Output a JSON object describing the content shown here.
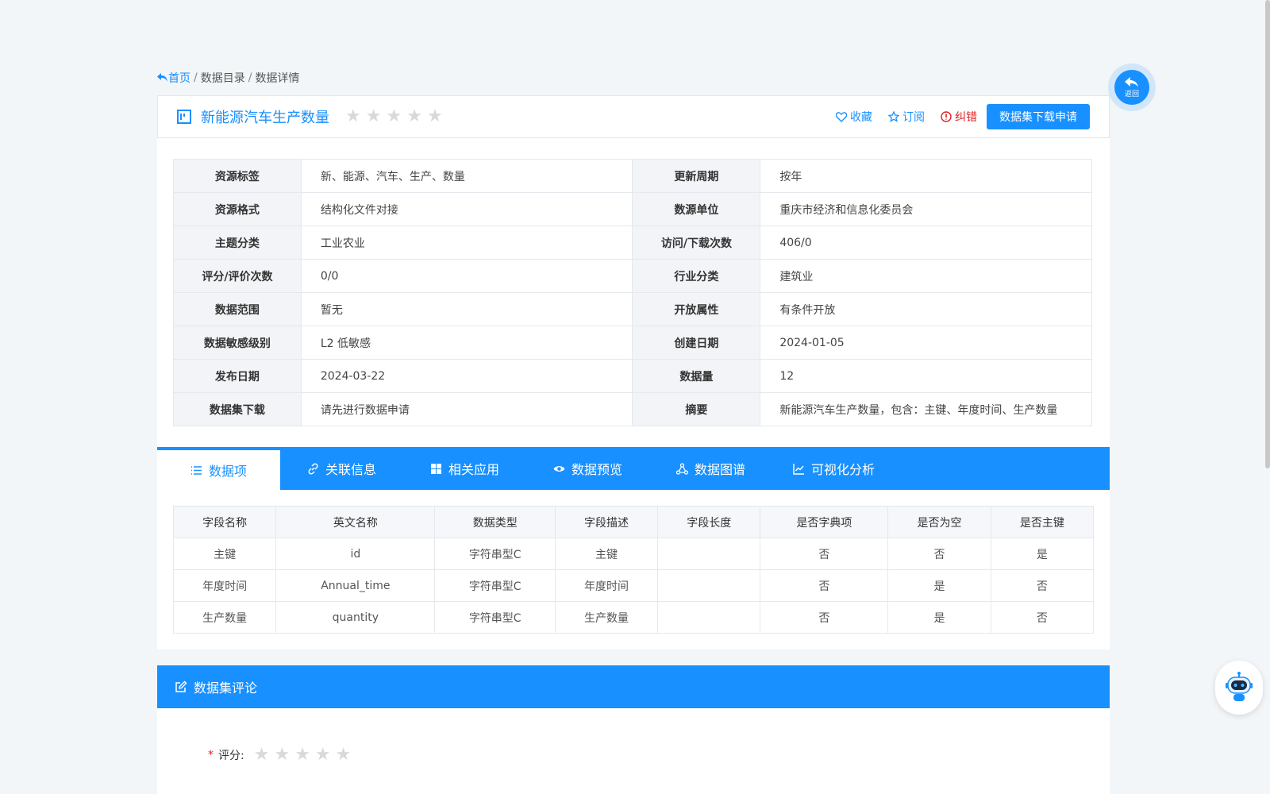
{
  "breadcrumb": {
    "home": "首页",
    "catalog": "数据目录",
    "detail": "数据详情"
  },
  "header": {
    "title": "新能源汽车生产数量",
    "favorite": "收藏",
    "subscribe": "订阅",
    "report_error": "纠错",
    "download_request": "数据集下载申请"
  },
  "info": [
    {
      "k1": "资源标签",
      "v1": "新、能源、汽车、生产、数量",
      "k2": "更新周期",
      "v2": "按年"
    },
    {
      "k1": "资源格式",
      "v1": "结构化文件对接",
      "k2": "数源单位",
      "v2": "重庆市经济和信息化委员会"
    },
    {
      "k1": "主题分类",
      "v1": "工业农业",
      "k2": "访问/下载次数",
      "v2": "406/0"
    },
    {
      "k1": "评分/评价次数",
      "v1": "0/0",
      "k2": "行业分类",
      "v2": "建筑业"
    },
    {
      "k1": "数据范围",
      "v1": "暂无",
      "k2": "开放属性",
      "v2": "有条件开放"
    },
    {
      "k1": "数据敏感级别",
      "v1": "L2 低敏感",
      "k2": "创建日期",
      "v2": "2024-01-05"
    },
    {
      "k1": "发布日期",
      "v1": "2024-03-22",
      "k2": "数据量",
      "v2": "12"
    },
    {
      "k1": "数据集下载",
      "v1": "请先进行数据申请",
      "k2": "摘要",
      "v2": "新能源汽车生产数量，包含：主键、年度时间、生产数量"
    }
  ],
  "tabs": [
    "数据项",
    "关联信息",
    "相关应用",
    "数据预览",
    "数据图谱",
    "可视化分析"
  ],
  "fields": {
    "headers": [
      "字段名称",
      "英文名称",
      "数据类型",
      "字段描述",
      "字段长度",
      "是否字典项",
      "是否为空",
      "是否主键"
    ],
    "rows": [
      [
        "主键",
        "id",
        "字符串型C",
        "主键",
        "",
        "否",
        "否",
        "是"
      ],
      [
        "年度时间",
        "Annual_time",
        "字符串型C",
        "年度时间",
        "",
        "否",
        "是",
        "否"
      ],
      [
        "生产数量",
        "quantity",
        "字符串型C",
        "生产数量",
        "",
        "否",
        "是",
        "否"
      ]
    ]
  },
  "comment": {
    "title": "数据集评论",
    "rating_label": "评分:"
  },
  "back_label": "返回",
  "colors": {
    "primary": "#1890ff",
    "error": "#e02020",
    "star_empty": "#d9d9d9"
  }
}
